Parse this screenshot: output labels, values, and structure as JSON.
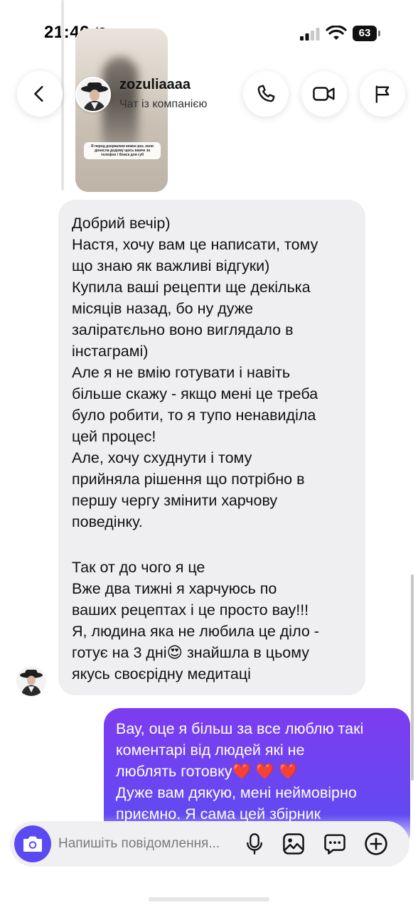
{
  "status_bar": {
    "time": "21:46",
    "battery": "63",
    "icons": [
      "bell-slash-icon",
      "cellular-signal-icon",
      "wifi-icon",
      "battery-icon"
    ]
  },
  "shared_story": {
    "caption": "Я перед дзеркалом кожен раз, коли донесла додому щось важче за телефон і блиск для губ"
  },
  "header": {
    "name": "zozuliaaaa",
    "subtitle": "Чат із компанією",
    "icons": [
      "back-arrow-icon",
      "phone-icon",
      "video-camera-icon",
      "flag-icon"
    ]
  },
  "messages": [
    {
      "direction": "incoming",
      "paragraphs": [
        "Добрий вечір)",
        "Настя, хочу вам це написати, тому\nщо знаю як важливі відгуки)",
        "Купила ваші рецепти ще декілька\nмісяців назад, бо ну дуже\nзаліратєльно воно виглядало в\nінстаграмі)",
        "Але я не вмію готувати і навіть\nбільше скажу - якщо мені це треба\nбуло робити, то я тупо ненавиділа\nцей процес!",
        "Але, хочу схуднути і тому\nприйняла рішення що потрібно в\nпершу чергу змінити харчову\nповедінку.",
        "",
        "Так от до чого я це",
        "Вже два тижні я харчуюсь по\nваших рецептах і це просто вау!!!",
        "Я, людина яка не любила це діло -\nготує на 3 дні😍  знайшла в цьому\nякусь своєрідну медитаці"
      ]
    },
    {
      "direction": "outgoing",
      "paragraphs": [
        "Вау, оце я більш за все люблю такі\nкоментарі від людей які не\nлюблять готовку❤️ ❤️ ❤️",
        "Дуже вам дякую, мені неймовірно\nприємно. Я сама цей збірник"
      ]
    }
  ],
  "composer": {
    "placeholder": "Напишіть повідомлення...",
    "icons": [
      "camera-icon",
      "microphone-icon",
      "gallery-icon",
      "sticker-icon",
      "plus-icon"
    ]
  },
  "colors": {
    "outgoing_bubble_top": "#7d3cf0",
    "outgoing_bubble_bottom": "#5a4ef2",
    "incoming_bubble": "#efeff2",
    "camera_button": "#5b4af1"
  }
}
